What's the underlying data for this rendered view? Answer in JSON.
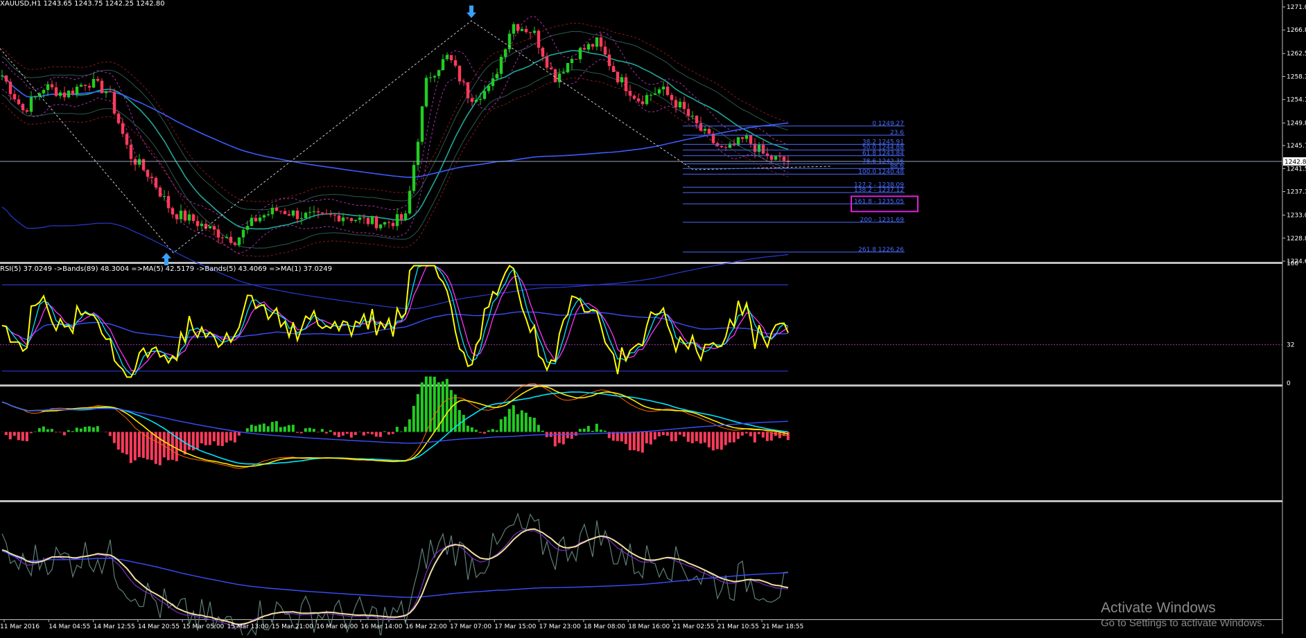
{
  "header": {
    "symbol_info": "XAUUSD,H1  1243.65 1243.75 1242.25 1242.80"
  },
  "subwindow_rsi": {
    "label": "RSI(5) 37.0249  ->Bands(89) 48.3004  =>MA(5) 42.5179  ->Bands(5) 43.4069  =>MA(1) 37.0249"
  },
  "watermark": {
    "line1": "Activate Windows",
    "line2": "Go to Settings to activate Windows."
  },
  "colors": {
    "background": "#000000",
    "bull": "#22cc22",
    "bear": "#ff3b5c",
    "ma_teal": "#1fa89a",
    "ma_blue": "#3a4fff",
    "fib": "#4a6cff",
    "highlight": "#e020e0",
    "rsi": "#ffff00",
    "cyan": "#00e5ff",
    "magenta": "#ff33ff"
  },
  "chart_data": [
    {
      "type": "candlestick",
      "title": "XAUUSD,H1",
      "ylim": [
        1224.6,
        1271.0
      ],
      "y_ticks": [
        "1271.0",
        "1266.8",
        "1262.5",
        "1258.3",
        "1254.1",
        "1249.8",
        "1245.7",
        "1241.5",
        "1237.3",
        "1233.0",
        "1228.8",
        "1224.6"
      ],
      "current_price": "1242.8",
      "x_ticks": [
        "11 Mar 2016",
        "14 Mar 04:55",
        "14 Mar 12:55",
        "14 Mar 20:55",
        "15 Mar 05:00",
        "15 Mar 13:00",
        "15 Mar 21:00",
        "16 Mar 06:00",
        "16 Mar 14:00",
        "16 Mar 22:00",
        "17 Mar 07:00",
        "17 Mar 15:00",
        "17 Mar 23:00",
        "18 Mar 08:00",
        "18 Mar 16:00",
        "21 Mar 02:55",
        "21 Mar 10:55",
        "21 Mar 18:55"
      ],
      "close_path": [
        1258.5,
        1252.0,
        1256.5,
        1255.0,
        1257.5,
        1255.5,
        1244.0,
        1240.0,
        1233.5,
        1232.0,
        1230.0,
        1228.5,
        1232.5,
        1234.0,
        1233.0,
        1232.5,
        1233.0,
        1232.0,
        1231.5,
        1232.5,
        1258.0,
        1262.0,
        1254.5,
        1256.0,
        1268.0,
        1266.5,
        1258.0,
        1262.5,
        1264.5,
        1258.0,
        1254.0,
        1256.0,
        1252.5,
        1248.0,
        1244.5,
        1247.0,
        1243.5,
        1242.8
      ],
      "fibonacci_levels": [
        {
          "label": "0 1249.27",
          "value": 1249.27
        },
        {
          "label": "23.6",
          "value": 1247.6
        },
        {
          "label": "38.2 1245.91",
          "value": 1245.91
        },
        {
          "label": "50.0 1244.88",
          "value": 1244.88
        },
        {
          "label": "61.8 1243.84",
          "value": 1243.84
        },
        {
          "label": "78.6 1242.36",
          "value": 1242.36
        },
        {
          "label": "88.6",
          "value": 1241.5
        },
        {
          "label": "100.0 1240.48",
          "value": 1240.48
        },
        {
          "label": "127.2 - 1238.09",
          "value": 1238.09
        },
        {
          "label": "138.2 - 1237.12",
          "value": 1237.12
        },
        {
          "label": "161.8 -  1235.05",
          "value": 1235.05
        },
        {
          "label": "200 - 1231.69",
          "value": 1231.69
        },
        {
          "label": "261.8 1226.26",
          "value": 1226.26
        }
      ]
    },
    {
      "type": "line",
      "title": "RSI(5)",
      "ylim": [
        0,
        100
      ],
      "y_ticks": [
        "100",
        "32",
        "0"
      ],
      "level": 32,
      "series": [
        {
          "name": "RSI(5)",
          "last": 37.0249
        },
        {
          "name": "Bands(89)",
          "last": 48.3004
        },
        {
          "name": "MA(5)",
          "last": 42.5179
        },
        {
          "name": "Bands(5)",
          "last": 43.4069
        },
        {
          "name": "MA(1)",
          "last": 37.0249
        }
      ]
    },
    {
      "type": "bar",
      "title": "",
      "ylim": [
        -1,
        1
      ]
    },
    {
      "type": "line",
      "title": "",
      "ylim": [
        0,
        1
      ]
    }
  ]
}
